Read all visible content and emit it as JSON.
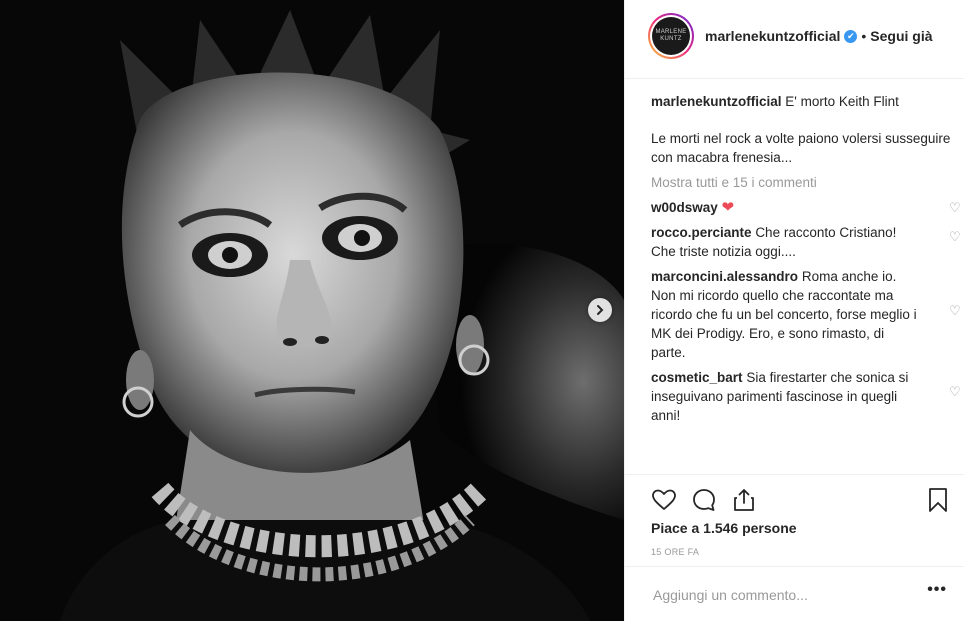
{
  "post": {
    "username": "marlenekuntzofficial",
    "verified_symbol": "✔",
    "separator": "•",
    "follow_label": "Segui già",
    "avatar_text_line1": "MARLENE",
    "avatar_text_line2": "KUNTZ",
    "caption": {
      "author": "marlenekuntzofficial",
      "title": "E' morto Keith Flint",
      "body": "Le morti nel rock a volte paiono volersi susseguire con macabra frenesia..."
    },
    "show_all_comments": "Mostra tutti e 15 i commenti",
    "comments": [
      {
        "user": "w00dsway",
        "text": "❤"
      },
      {
        "user": "rocco.perciante",
        "text": "Che racconto Cristiano! Che triste notizia oggi...."
      },
      {
        "user": "marconcini.alessandro",
        "text": "Roma anche io. Non mi ricordo quello che raccontate ma ricordo che fu un bel concerto, forse meglio i MK dei Prodigy. Ero, e sono rimasto, di parte."
      },
      {
        "user": "cosmetic_bart",
        "text": "Sia firestarter che sonica si inseguivano parimenti fascinose in quegli anni!"
      }
    ],
    "likes_text": "Piace a 1.546 persone",
    "time_text": "15 ORE FA",
    "add_comment_placeholder": "Aggiungi un commento...",
    "more_label": "•••"
  },
  "icons": {
    "like": "heart-outline-icon",
    "comment": "comment-bubble-icon",
    "share": "share-upload-icon",
    "save": "bookmark-icon",
    "next": "chevron-right-icon"
  },
  "colors": {
    "verified": "#3897f0",
    "heart_red": "#ed4956",
    "muted_text": "#999999"
  }
}
